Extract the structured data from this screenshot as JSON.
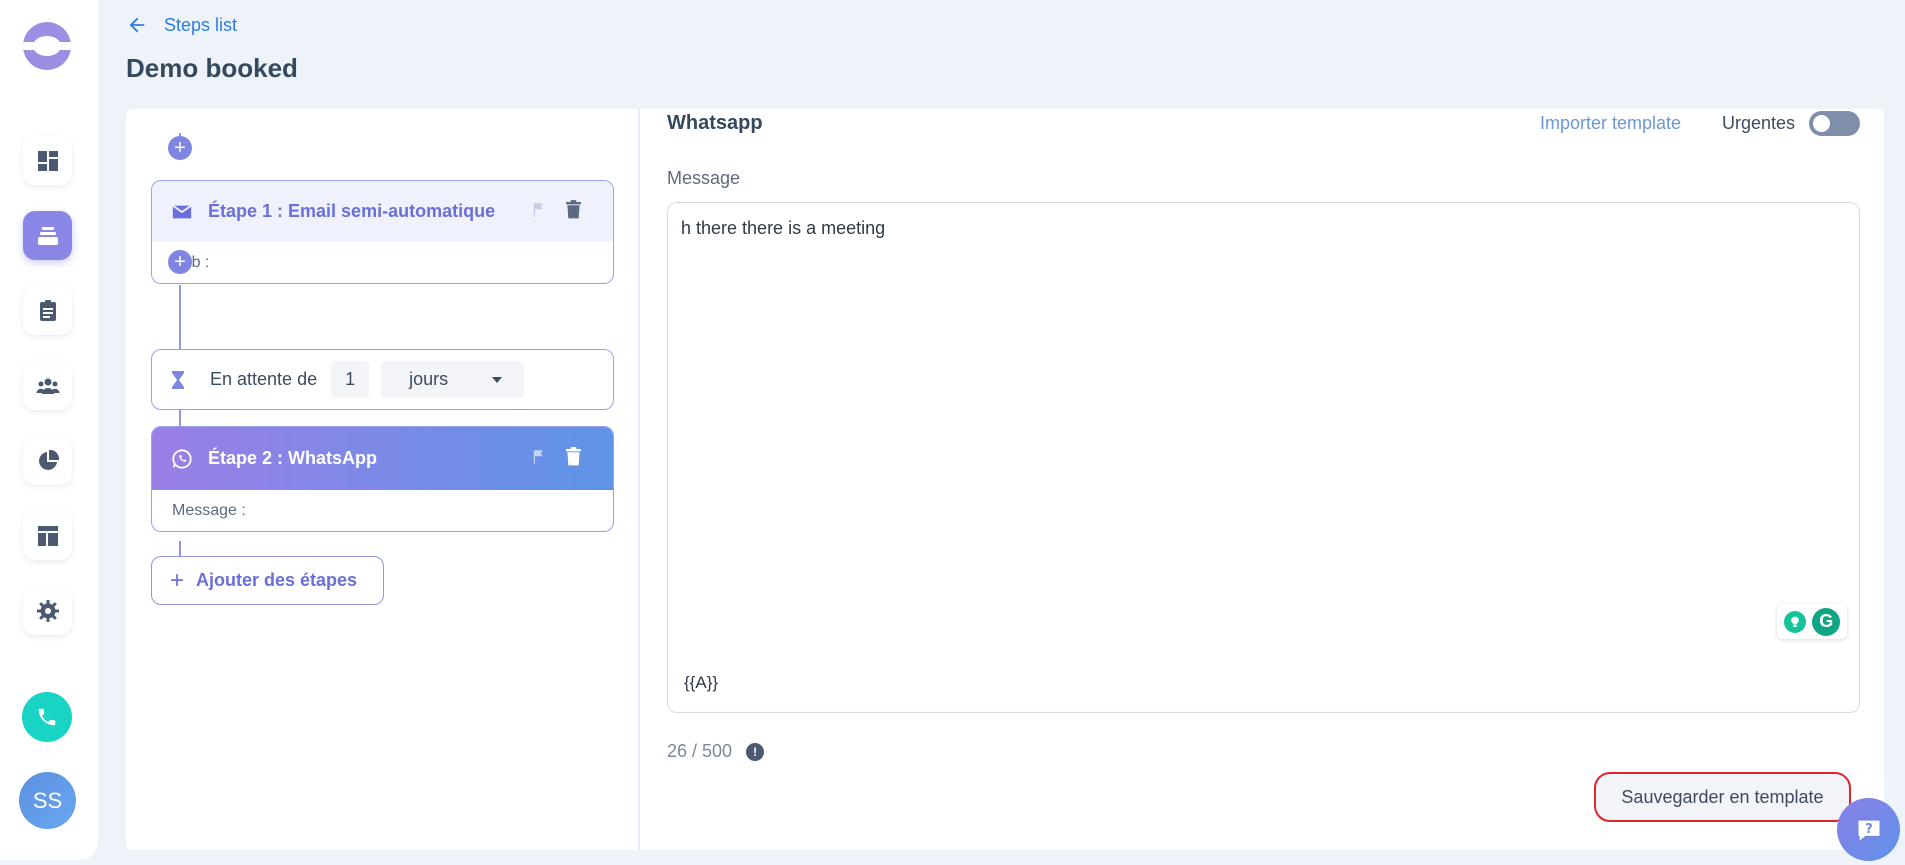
{
  "header": {
    "back_label": "Steps list",
    "title": "Demo booked"
  },
  "sidebar": {
    "items": [
      {
        "icon": "dashboard-icon"
      },
      {
        "icon": "sequences-icon",
        "active": true
      },
      {
        "icon": "clipboard-icon"
      },
      {
        "icon": "contacts-icon"
      },
      {
        "icon": "analytics-icon"
      },
      {
        "icon": "templates-icon"
      },
      {
        "icon": "settings-icon"
      }
    ],
    "avatar_initials": "SS"
  },
  "steps": {
    "step1": {
      "title": "Étape 1 : Email semi-automatique",
      "body": "Sub :"
    },
    "wait": {
      "label": "En attente de",
      "value": "1",
      "unit": "jours"
    },
    "step2": {
      "title": "Étape 2 : WhatsApp",
      "body": "Message :"
    },
    "add_label": "Ajouter des étapes"
  },
  "editor": {
    "channel_title": "Whatsapp",
    "import_label": "Importer template",
    "urgent_label": "Urgentes",
    "urgent_on": false,
    "message_label": "Message",
    "message_text": "h there there is a meeting",
    "variable": "{{A}}",
    "counter": "26 / 500",
    "save_template_label": "Sauvegarder en template"
  },
  "colors": {
    "accent": "#7f86e2",
    "link": "#2b7de0",
    "highlight_border": "#e0242b"
  }
}
